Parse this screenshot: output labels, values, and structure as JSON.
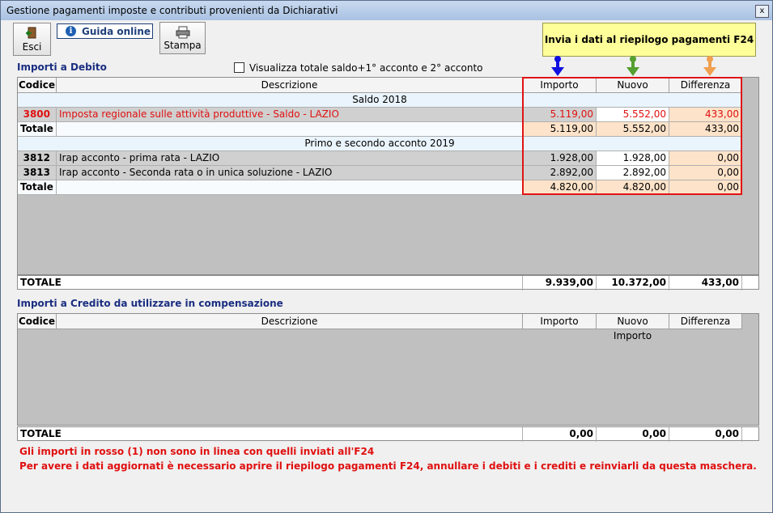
{
  "window": {
    "title": "Gestione pagamenti imposte e contributi provenienti da Dichiarativi",
    "close": "x"
  },
  "toolbar": {
    "esci": "Esci",
    "guida": "Guida online",
    "stampa": "Stampa",
    "invia": "Invia i dati al riepilogo pagamenti F24"
  },
  "debito": {
    "title": "Importi a Debito",
    "checkbox_label": "Visualizza totale saldo+1° acconto e 2° acconto",
    "columns": {
      "codice": "Codice",
      "descrizione": "Descrizione",
      "importo": "Importo",
      "nuovo": "Nuovo Importo",
      "differenza": "Differenza"
    },
    "group1": "Saldo 2018",
    "r3800": {
      "codice": "3800",
      "descrizione": "Imposta regionale sulle attività produttive - Saldo - LAZIO",
      "importo": "5.119,00",
      "nuovo": "5.552,00",
      "differenza": "433,00"
    },
    "tot1": {
      "label": "Totale",
      "importo": "5.119,00",
      "nuovo": "5.552,00",
      "differenza": "433,00"
    },
    "group2": "Primo e secondo acconto 2019",
    "r3812": {
      "codice": "3812",
      "descrizione": "Irap acconto - prima rata - LAZIO",
      "importo": "1.928,00",
      "nuovo": "1.928,00",
      "differenza": "0,00"
    },
    "r3813": {
      "codice": "3813",
      "descrizione": "Irap acconto - Seconda rata o in unica soluzione - LAZIO",
      "importo": "2.892,00",
      "nuovo": "2.892,00",
      "differenza": "0,00"
    },
    "tot2": {
      "label": "Totale",
      "importo": "4.820,00",
      "nuovo": "4.820,00",
      "differenza": "0,00"
    },
    "totale": {
      "label": "TOTALE",
      "importo": "9.939,00",
      "nuovo": "10.372,00",
      "differenza": "433,00"
    }
  },
  "credito": {
    "title": "Importi a Credito da utilizzare in compensazione",
    "columns": {
      "codice": "Codice",
      "descrizione": "Descrizione",
      "importo": "Importo",
      "nuovo": "Nuovo Importo",
      "differenza": "Differenza"
    },
    "totale": {
      "label": "TOTALE",
      "importo": "0,00",
      "nuovo": "0,00",
      "differenza": "0,00"
    }
  },
  "notes": {
    "line1": "Gli importi in rosso (1) non sono in linea con quelli inviati all'F24",
    "line2": "Per avere i dati aggiornati è necessario aprire il riepilogo pagamenti F24, annullare i debiti e i crediti e reinviarli da questa maschera."
  },
  "colors": {
    "arrow_importo": "#1010e0",
    "arrow_nuovo": "#55a030",
    "arrow_differenza": "#f0a050",
    "highlight_box": "#e01414"
  }
}
